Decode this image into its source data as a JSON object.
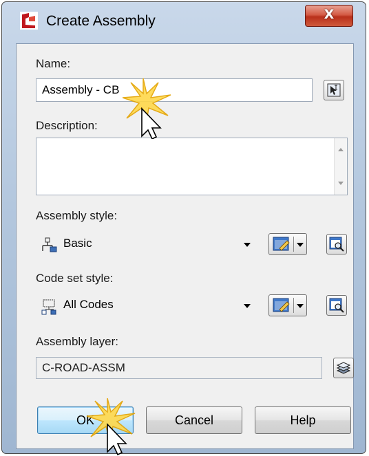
{
  "window": {
    "title": "Create Assembly",
    "close_label": "X"
  },
  "name": {
    "label": "Name:",
    "value": "Assembly - CB"
  },
  "description": {
    "label": "Description:",
    "value": ""
  },
  "assembly_style": {
    "label": "Assembly style:",
    "value": "Basic"
  },
  "code_set_style": {
    "label": "Code set style:",
    "value": "All Codes"
  },
  "assembly_layer": {
    "label": "Assembly layer:",
    "value": "C-ROAD-ASSM"
  },
  "buttons": {
    "ok": "OK",
    "cancel": "Cancel",
    "help": "Help"
  }
}
